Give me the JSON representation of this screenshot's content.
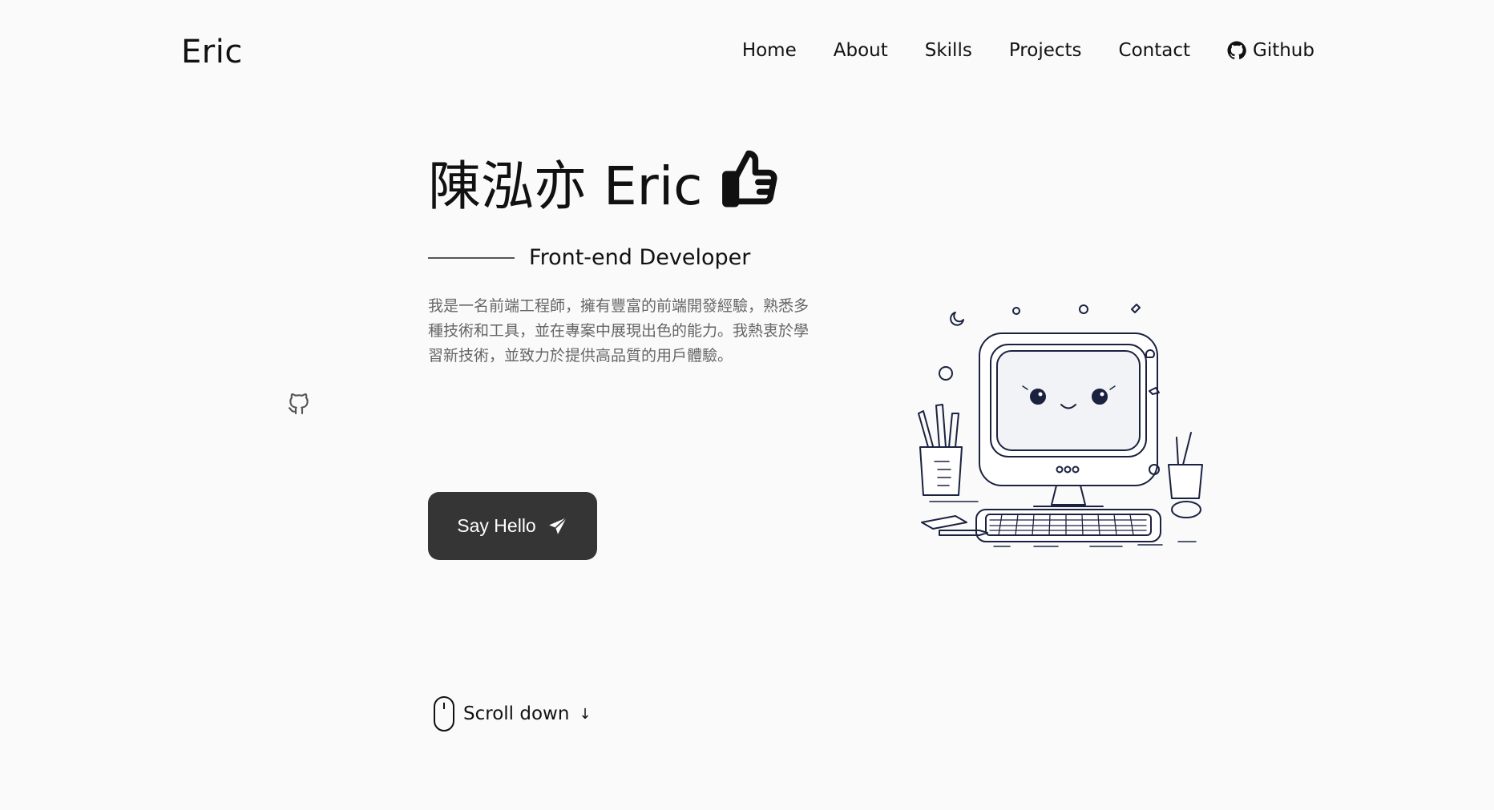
{
  "header": {
    "logo": "Eric",
    "nav": [
      {
        "label": "Home"
      },
      {
        "label": "About"
      },
      {
        "label": "Skills"
      },
      {
        "label": "Projects"
      },
      {
        "label": "Contact"
      },
      {
        "label": "Github",
        "icon": "github-icon"
      }
    ]
  },
  "hero": {
    "title": "陳泓亦 Eric",
    "title_icon": "thumbs-up-icon",
    "subtitle": "Front-end Developer",
    "description": "我是一名前端工程師，擁有豐富的前端開發經驗，熟悉多種技術和工具，並在專案中展現出色的能力。我熱衷於學習新技術，並致力於提供高品質的用戶體驗。",
    "cta_label": "Say Hello",
    "cta_icon": "send-icon"
  },
  "side_social": {
    "icon": "github-icon"
  },
  "scroll": {
    "label": "Scroll down",
    "icon": "mouse-icon",
    "arrow": "↓"
  },
  "illustration": {
    "icon": "computer-desk-illustration"
  },
  "colors": {
    "background": "#fafafa",
    "button": "#353535",
    "text": "#111111",
    "muted": "#666666"
  }
}
